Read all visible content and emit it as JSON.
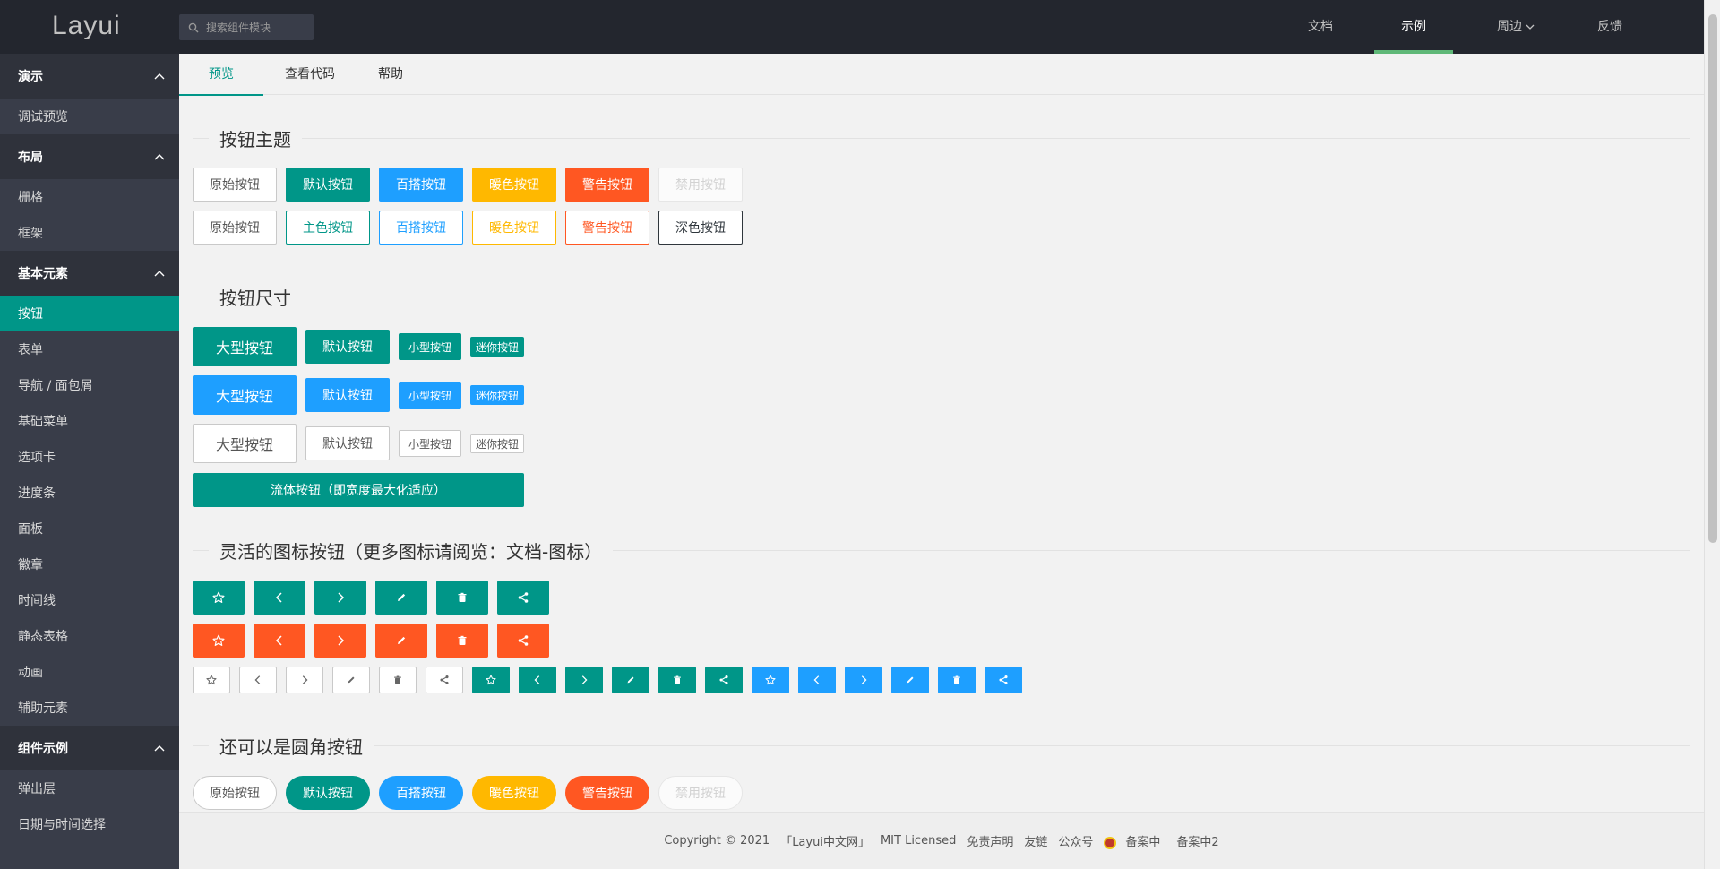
{
  "header": {
    "logo": "Layui",
    "search_placeholder": "搜索组件模块",
    "nav": [
      {
        "label": "文档"
      },
      {
        "label": "示例"
      },
      {
        "label": "周边"
      },
      {
        "label": "反馈"
      }
    ]
  },
  "sidebar": {
    "groups": [
      {
        "label": "演示",
        "items": [
          "调试预览"
        ]
      },
      {
        "label": "布局",
        "items": [
          "栅格",
          "框架"
        ]
      },
      {
        "label": "基本元素",
        "items": [
          "按钮",
          "表单",
          "导航 / 面包屑",
          "基础菜单",
          "选项卡",
          "进度条",
          "面板",
          "徽章",
          "时间线",
          "静态表格",
          "动画",
          "辅助元素"
        ]
      },
      {
        "label": "组件示例",
        "items": [
          "弹出层",
          "日期与时间选择"
        ]
      }
    ],
    "active_item": "按钮"
  },
  "tabs": [
    "预览",
    "查看代码",
    "帮助"
  ],
  "sections": {
    "theme": {
      "title": "按钮主题",
      "row1": [
        "原始按钮",
        "默认按钮",
        "百搭按钮",
        "暖色按钮",
        "警告按钮",
        "禁用按钮"
      ],
      "row2": [
        "原始按钮",
        "主色按钮",
        "百搭按钮",
        "暖色按钮",
        "警告按钮",
        "深色按钮"
      ]
    },
    "size": {
      "title": "按钮尺寸",
      "lg": "大型按钮",
      "md": "默认按钮",
      "sm": "小型按钮",
      "xs": "迷你按钮",
      "fluid": "流体按钮（即宽度最大化适应）"
    },
    "icon": {
      "title": "灵活的图标按钮（更多图标请阅览：文档-图标）",
      "icons": [
        "star-icon",
        "chevron-left-icon",
        "chevron-right-icon",
        "pencil-icon",
        "trash-icon",
        "share-icon"
      ]
    },
    "round": {
      "title": "还可以是圆角按钮",
      "buttons": [
        "原始按钮",
        "默认按钮",
        "百搭按钮",
        "暖色按钮",
        "警告按钮",
        "禁用按钮"
      ]
    }
  },
  "footer": {
    "copyright": "Copyright © 2021",
    "site": "「Layui中文网」",
    "license": "MIT Licensed",
    "disclaimer": "免责声明",
    "links": "友链",
    "wechat": "公众号",
    "icp1": "备案中",
    "icp2": "备案中2"
  },
  "colors": {
    "primary": "#009688",
    "normal": "#1e9fff",
    "warm": "#ffb800",
    "danger": "#ff5722",
    "header_bg": "#23262e",
    "sidebar_bg": "#393d49"
  }
}
